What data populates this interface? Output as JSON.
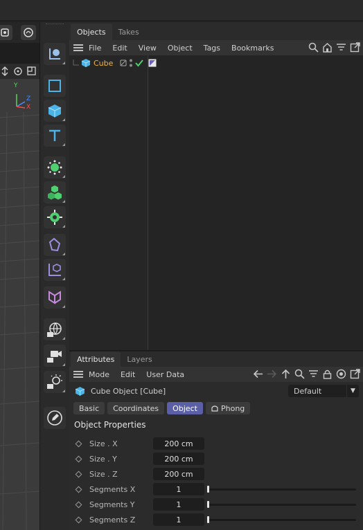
{
  "objects_manager": {
    "tabs": [
      "Objects",
      "Takes"
    ],
    "menu": [
      "File",
      "Edit",
      "View",
      "Object",
      "Tags",
      "Bookmarks"
    ],
    "tree": [
      {
        "name": "Cube",
        "icon": "cube-icon"
      }
    ],
    "toolbar_icons": [
      "search-icon",
      "home-icon",
      "filter-icon",
      "new-window-icon"
    ]
  },
  "palette_icons": [
    "coordinate-system-icon",
    "box-select-icon",
    "cube-primitive-icon",
    "text-icon",
    "generator-icon",
    "cloner-icon",
    "deformer-gear-icon",
    "spline-icon",
    "null-object-icon",
    "field-icon",
    "sky-globe-icon",
    "camera-icon",
    "light-icon",
    "edit-pen-icon"
  ],
  "attributes": {
    "tabs": [
      "Attributes",
      "Layers"
    ],
    "menu": [
      "Mode",
      "Edit",
      "User Data"
    ],
    "title": "Cube Object [Cube]",
    "preset": "Default",
    "subtabs": [
      "Basic",
      "Coordinates",
      "Object",
      "Phong"
    ],
    "active_subtab": "Object",
    "section": "Object Properties",
    "properties": [
      {
        "label": "Size . X",
        "value": "200 cm"
      },
      {
        "label": "Size . Y",
        "value": "200 cm"
      },
      {
        "label": "Size . Z",
        "value": "200 cm"
      },
      {
        "label": "Segments X",
        "value": "1",
        "slider": 0.0
      },
      {
        "label": "Segments Y",
        "value": "1",
        "slider": 0.0
      },
      {
        "label": "Segments Z",
        "value": "1",
        "slider": 0.0
      }
    ]
  },
  "viewport": {
    "axis_labels": [
      "Y",
      "Z",
      "X"
    ]
  },
  "colors": {
    "accent": "#5a5fa8",
    "object_name": "#f0b23a",
    "palette_blue": "#4ab3e8",
    "palette_green": "#4fcf70",
    "palette_purple": "#9b8fe0",
    "palette_pink": "#c88ae0"
  }
}
